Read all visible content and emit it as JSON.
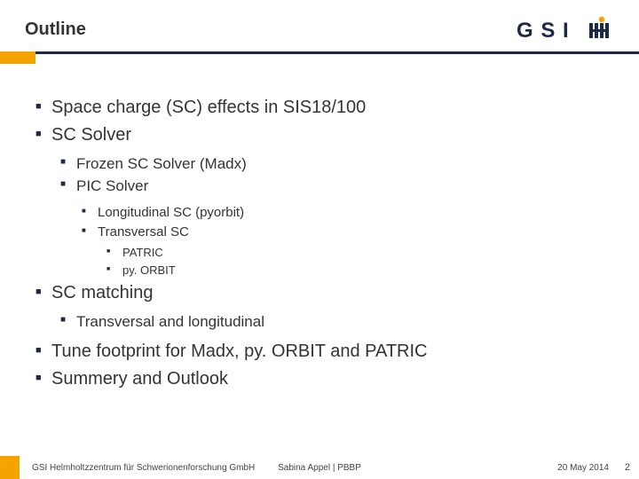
{
  "title": "Outline",
  "logo_alt": "GSI",
  "bullets": {
    "l1_a": "Space charge (SC) effects in SIS18/100",
    "l1_b": "SC Solver",
    "l2_a": "Frozen SC Solver (Madx)",
    "l2_b": "PIC Solver",
    "l3_a": "Longitudinal SC (pyorbit)",
    "l3_b": "Transversal SC",
    "l4_a": "PATRIC",
    "l4_b": "py. ORBIT",
    "l1_c": "SC matching",
    "l2_c": "Transversal and longitudinal",
    "l1_d": "Tune footprint for Madx, py. ORBIT and PATRIC",
    "l1_e": "Summery and Outlook"
  },
  "footer": {
    "left": "GSI Helmholtzzentrum für Schwerionenforschung GmbH",
    "center": "Sabina Appel | PBBP",
    "right": "20 May 2014",
    "page": "2"
  }
}
